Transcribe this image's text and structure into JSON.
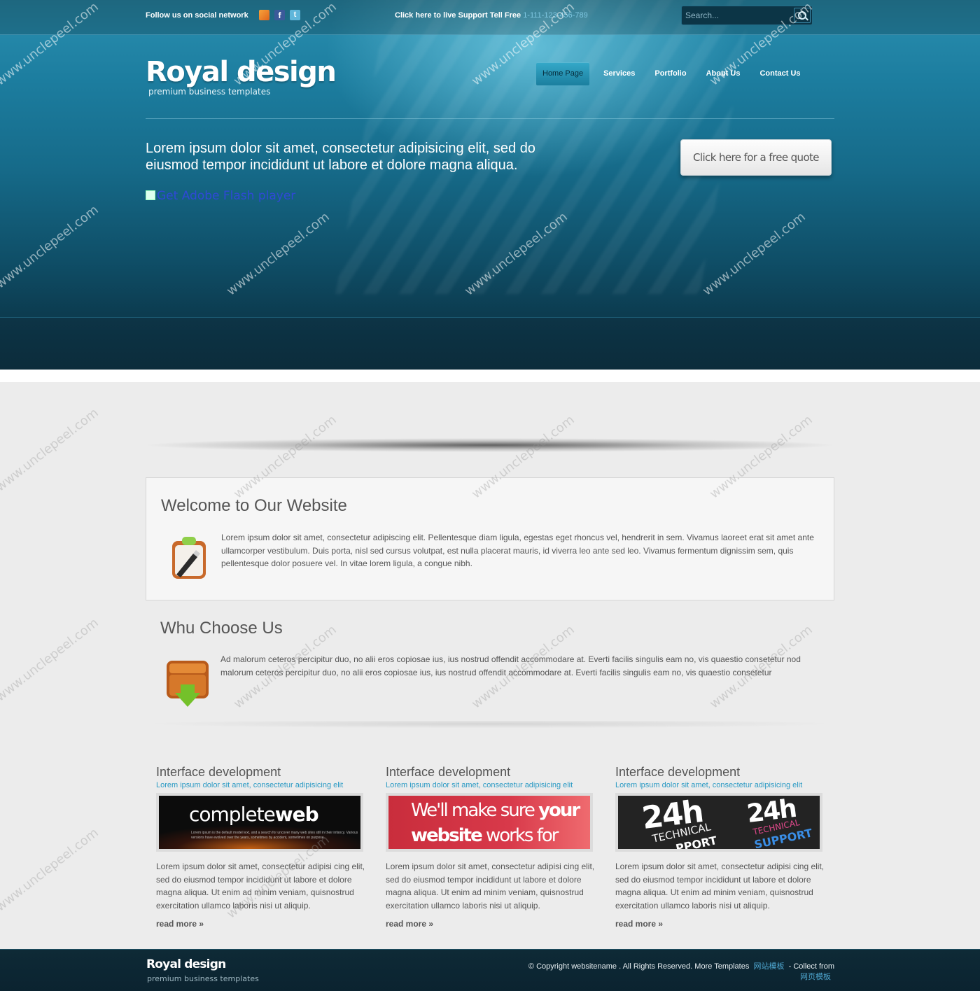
{
  "topbar": {
    "follow_label": "Follow us on social network",
    "support_label": "Click here to live Support Tell Free",
    "support_phone": "1-111-123-456-789",
    "search_placeholder": "Search..."
  },
  "brand": {
    "logo": "Royal design",
    "tagline": "premium business templates"
  },
  "nav": {
    "items": [
      "Home Page",
      "Services",
      "Portfolio",
      "About Us",
      "Contact Us"
    ],
    "active": "Home Page"
  },
  "hero": {
    "text": "Lorem ipsum dolor sit amet, consectetur adipisicing elit, sed do eiusmod tempor incididunt ut labore et dolore magna aliqua.",
    "flash_link": "Get Adobe Flash player",
    "quote_button": "Click here for a free quote"
  },
  "welcome": {
    "title": "Welcome to Our Website",
    "text": "Lorem ipsum dolor sit amet, consectetur adipiscing elit. Pellentesque diam ligula, egestas eget rhoncus vel, hendrerit in sem. Vivamus laoreet erat sit amet ante ullamcorper vestibulum. Duis porta, nisl sed cursus volutpat, est nulla placerat mauris, id viverra leo ante sed leo. Vivamus fermentum dignissim sem, quis pellentesque dolor posuere vel. In vitae lorem ligula, a congue nibh."
  },
  "why": {
    "title": "Whu Choose Us",
    "text": "Ad malorum ceteros percipitur duo, no alii eros copiosae ius, ius nostrud offendit accommodare at. Everti facilis singulis eam no, vis quaestio consetetur nod malorum ceteros percipitur duo, no alii eros copiosae ius, ius nostrud offendit accommodare at. Everti facilis singulis eam no, vis quaestio consetetur"
  },
  "columns": [
    {
      "title": "Interface development",
      "subtitle": "Lorem ipsum dolor sit amet, consectetur adipisicing elit",
      "text": "Lorem ipsum dolor sit amet, consectetur adipisi cing elit, sed do eiusmod tempor incididunt ut labore et dolore magna aliqua. Ut enim ad minim veniam, quisnostrud exercitation ullamco laboris nisi ut aliquip.",
      "read_more": "read more »",
      "image": {
        "word1": "complete",
        "word2": "web",
        "fine": "Lorem ipsum is the default model text, and a search for uncover many web sites still in their infancy. Various versions have evolved over the years, sometimes by accident, sometimes on purpose."
      }
    },
    {
      "title": "Interface development",
      "subtitle": "Lorem ipsum dolor sit amet, consectetur adipisicing elit",
      "text": "Lorem ipsum dolor sit amet, consectetur adipisi cing elit, sed do eiusmod tempor incididunt ut labore et dolore magna aliqua. Ut enim ad minim veniam, quisnostrud exercitation ullamco laboris nisi ut aliquip.",
      "read_more": "read more »",
      "image": {
        "line1a": "We'll make sure",
        "line1b": "your",
        "line2a": "website",
        "line2b": "works for you!"
      }
    },
    {
      "title": "Interface development",
      "subtitle": "Lorem ipsum dolor sit amet, consectetur adipisicing elit",
      "text": "Lorem ipsum dolor sit amet, consectetur adipisi cing elit, sed do eiusmod tempor incididunt ut labore et dolore magna aliqua. Ut enim ad minim veniam, quisnostrud exercitation ullamco laboris nisi ut aliquip.",
      "read_more": "read more »",
      "image": {
        "big": "24h",
        "technical": "TECHNICAL",
        "support1": "PPORT",
        "support2": "SUPPORT"
      }
    }
  ],
  "footer": {
    "logo": "Royal design",
    "tagline": "premium business templates",
    "copyright": "© Copyright websitename . All Rights Reserved. More Templates",
    "link1": "网站模板",
    "collect": "- Collect from",
    "link2": "网页模板"
  },
  "watermark": "www.unclepeel.com",
  "icons": [
    "rss-icon",
    "facebook-icon",
    "twitter-icon",
    "search-icon",
    "clipboard-icon",
    "download-box-icon"
  ],
  "colors": {
    "accent": "#2b9ac4",
    "hero": "#166b8a",
    "footer": "#0e2a36"
  }
}
